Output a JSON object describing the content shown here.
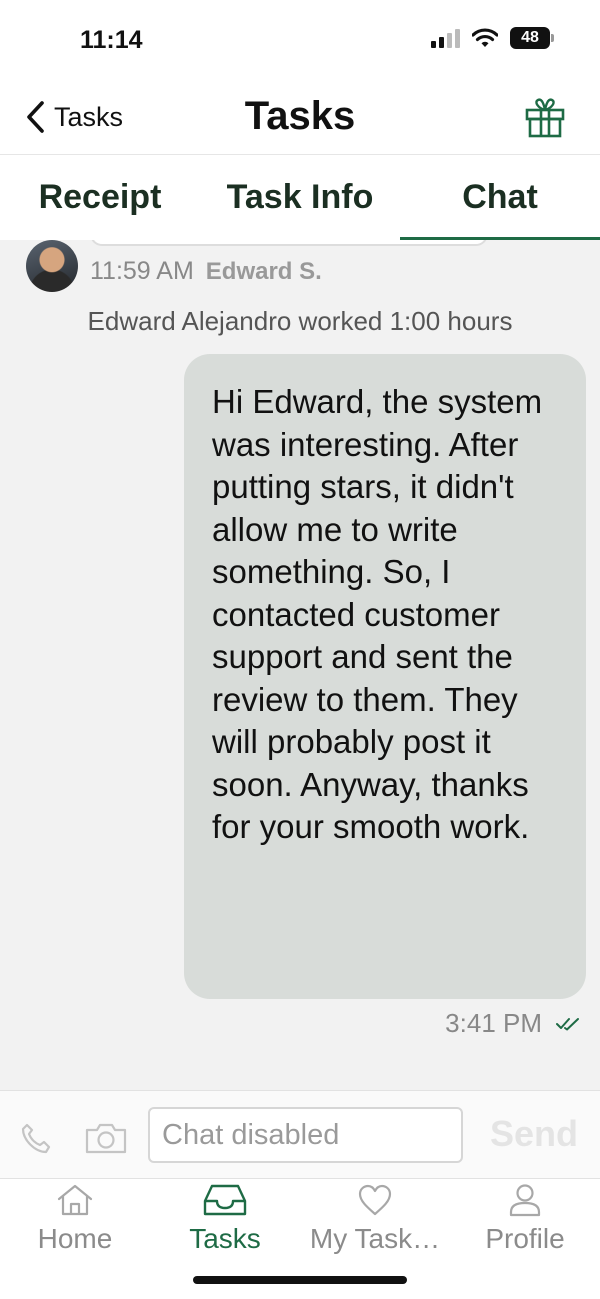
{
  "status_bar": {
    "time": "11:14",
    "battery": "48"
  },
  "nav": {
    "back_label": "Tasks",
    "title": "Tasks"
  },
  "tabs": [
    {
      "label": "Receipt"
    },
    {
      "label": "Task Info"
    },
    {
      "label": "Chat",
      "active": true
    }
  ],
  "chat": {
    "sender_time": "11:59 AM",
    "sender_name": "Edward S.",
    "system_message": "Edward Alejandro worked 1:00 hours",
    "outgoing_message": "Hi Edward, the system was interesting. After putting stars, it didn't allow me to write something. So, I contacted customer support and sent the review to them. They will probably post it soon. Anyway, thanks for your smooth work.",
    "outgoing_time": "3:41 PM"
  },
  "composer": {
    "placeholder": "Chat disabled",
    "send_label": "Send"
  },
  "bottom_tabs": [
    {
      "label": "Home",
      "icon": "home-icon"
    },
    {
      "label": "Tasks",
      "icon": "inbox-icon",
      "active": true
    },
    {
      "label": "My Task…",
      "icon": "heart-icon"
    },
    {
      "label": "Profile",
      "icon": "person-icon"
    }
  ],
  "colors": {
    "accent": "#1e6b45",
    "bubble": "#d8dcd9",
    "background": "#f2f2f2"
  }
}
